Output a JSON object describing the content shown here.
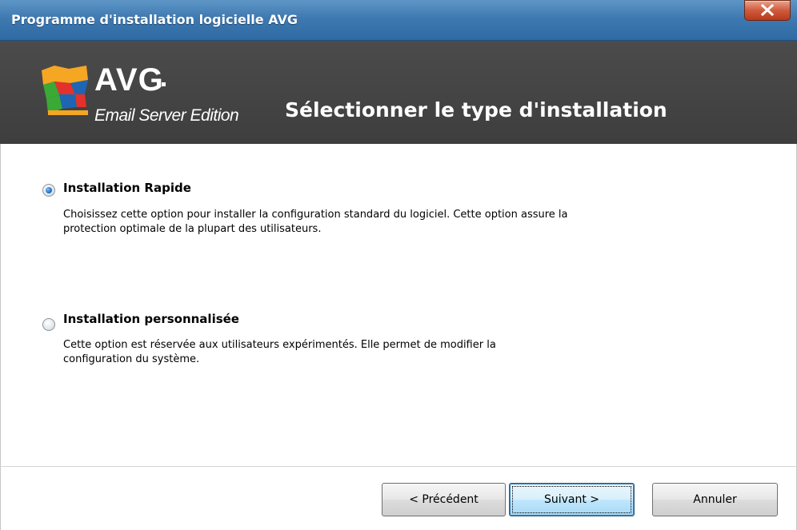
{
  "window": {
    "title": "Programme d'installation logicielle AVG",
    "close_symbol": "X"
  },
  "banner": {
    "logo_brand": "AVG",
    "logo_edition": "Email Server Edition",
    "heading": "Sélectionner le type d'installation"
  },
  "options": [
    {
      "label": "Installation Rapide",
      "description": "Choisissez cette option pour installer la configuration standard du logiciel. Cette option assure la protection optimale de la plupart des utilisateurs.",
      "selected": true
    },
    {
      "label": "Installation personnalisée",
      "description": "Cette option est réservée aux utilisateurs expérimentés. Elle permet de modifier la configuration du système.",
      "selected": false
    }
  ],
  "buttons": {
    "back_label": "< Précédent",
    "next_label": "Suivant >",
    "cancel_label": "Annuler"
  },
  "colors": {
    "titlebar": "#3f79b0",
    "banner": "#444444",
    "close": "#c84a2c"
  }
}
